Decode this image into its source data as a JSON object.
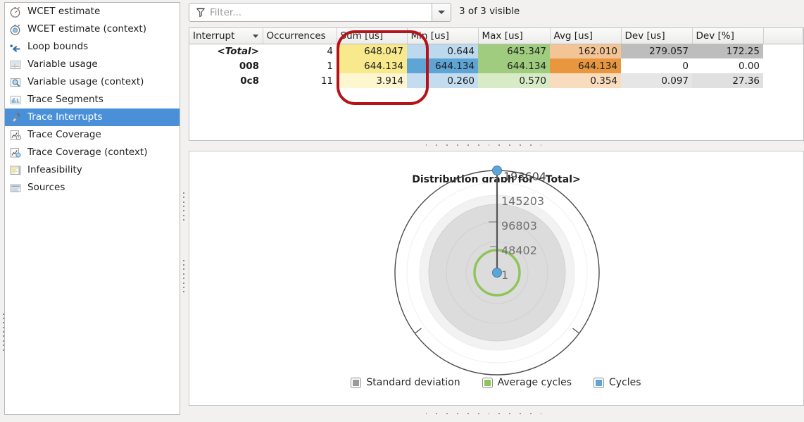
{
  "sidebar": {
    "items": [
      {
        "label": "WCET estimate",
        "icon": "stopwatch-icon",
        "selected": false
      },
      {
        "label": "WCET estimate (context)",
        "icon": "stopwatch-context-icon",
        "selected": false
      },
      {
        "label": "Loop bounds",
        "icon": "loop-arrow-icon",
        "selected": false
      },
      {
        "label": "Variable usage",
        "icon": "table-icon",
        "selected": false
      },
      {
        "label": "Variable usage (context)",
        "icon": "table-magnifier-icon",
        "selected": false
      },
      {
        "label": "Trace Segments",
        "icon": "bar-chart-icon",
        "selected": false
      },
      {
        "label": "Trace Interrupts",
        "icon": "plug-icon",
        "selected": true
      },
      {
        "label": "Trace Coverage",
        "icon": "coverage-icon",
        "selected": false
      },
      {
        "label": "Trace Coverage (context)",
        "icon": "coverage-context-icon",
        "selected": false
      },
      {
        "label": "Infeasibility",
        "icon": "highlight-code-icon",
        "selected": false
      },
      {
        "label": "Sources",
        "icon": "sources-icon",
        "selected": false
      }
    ],
    "selected_color": "#4a90d9"
  },
  "filter": {
    "placeholder": "Filter...",
    "value": "",
    "icon": "funnel-icon",
    "dropdown_icon": "chevron-down-icon",
    "visible_count": "3 of 3 visible"
  },
  "table": {
    "columns": [
      {
        "label": "Interrupt",
        "sorted": true,
        "align": "left"
      },
      {
        "label": "Occurrences",
        "sorted": false,
        "align": "right"
      },
      {
        "label": "Sum [us]",
        "sorted": false,
        "align": "right"
      },
      {
        "label": "Min [us]",
        "sorted": false,
        "align": "right"
      },
      {
        "label": "Max [us]",
        "sorted": false,
        "align": "right"
      },
      {
        "label": "Avg [us]",
        "sorted": false,
        "align": "right"
      },
      {
        "label": "Dev [us]",
        "sorted": false,
        "align": "right"
      },
      {
        "label": "Dev [%]",
        "sorted": false,
        "align": "right"
      }
    ],
    "rows": [
      {
        "interrupt": "<Total>",
        "total": true,
        "occurrences": "4",
        "sum": "648.047",
        "min": "0.644",
        "max": "645.347",
        "avg": "162.010",
        "dev_us": "279.057",
        "dev_pct": "172.25",
        "colors": {
          "sum": "#f7e98c",
          "min": "#bdd9ee",
          "max": "#9fcc7e",
          "avg": "#f3c596",
          "dev_us": "#bdbdbd",
          "dev_pct": "#bdbdbd"
        }
      },
      {
        "interrupt": "008",
        "total": false,
        "occurrences": "1",
        "sum": "644.134",
        "min": "644.134",
        "max": "644.134",
        "avg": "644.134",
        "dev_us": "0",
        "dev_pct": "0.00",
        "colors": {
          "sum": "#f7e98c",
          "min": "#5ea4d4",
          "max": "#9fcc7e",
          "avg": "#e8973f",
          "dev_us": "#ffffff",
          "dev_pct": "#ffffff"
        }
      },
      {
        "interrupt": "0c8",
        "total": false,
        "occurrences": "11",
        "sum": "3.914",
        "min": "0.260",
        "max": "0.570",
        "avg": "0.354",
        "dev_us": "0.097",
        "dev_pct": "27.36",
        "colors": {
          "sum": "#fdf6cf",
          "min": "#c4dcef",
          "max": "#d8ebc7",
          "avg": "#f9dcbd",
          "dev_us": "#e6e6e6",
          "dev_pct": "#e0e0e0"
        }
      }
    ],
    "annotation": {
      "shape": "red-rounded-rect",
      "color": "#b5121b",
      "targets": "Sum [us] column"
    }
  },
  "graph": {
    "title": "Distribution graph for <Total>",
    "legend": [
      {
        "label": "Standard deviation",
        "color": "#9a9a9a"
      },
      {
        "label": "Average cycles",
        "color": "#8fc45c"
      },
      {
        "label": "Cycles",
        "color": "#5ea4d4"
      }
    ]
  },
  "chart_data": {
    "type": "radial",
    "title": "Distribution graph for <Total>",
    "radial_axis_ticks": [
      1,
      48402,
      96803,
      145203,
      193604
    ],
    "tick_labels": [
      "1",
      "48402",
      "96803",
      "145203",
      "193604"
    ],
    "rmin": 1,
    "rmax": 193604,
    "series": [
      {
        "name": "Cycles",
        "color": "#5ea4d4",
        "type": "radius-line",
        "inner_point": 1,
        "outer_point": 193604
      },
      {
        "name": "Average cycles",
        "color": "#8fc45c",
        "type": "circle",
        "value": 30000
      },
      {
        "name": "Standard deviation",
        "color": "#9a9a9a",
        "type": "filled-disc",
        "value": 130000
      }
    ],
    "outer_boundary": 193604,
    "grid": true,
    "legend_position": "bottom"
  }
}
